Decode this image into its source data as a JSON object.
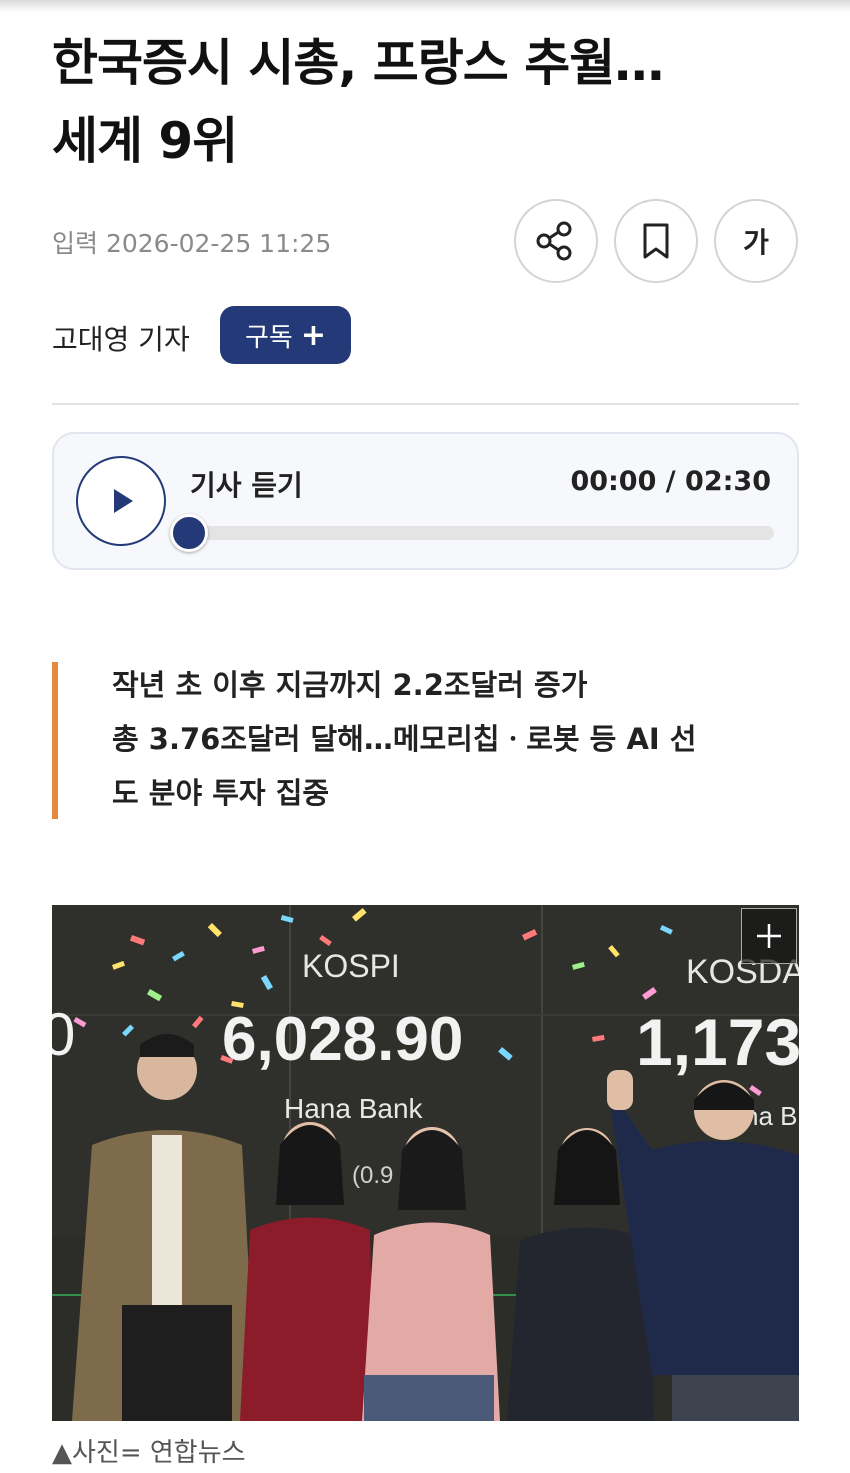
{
  "article": {
    "headline_line1": "한국증시 시총, 프랑스 추월…",
    "headline_line2": "세계 9위",
    "published": "입력 2026-02-25 11:25",
    "reporter": "고대영 기자",
    "subscribe_label": "구독",
    "subscribe_plus": "+",
    "font_size_label": "가",
    "summary_lines": [
      "작년 초 이후 지금까지 2.2조달러 증가",
      "총 3.76조달러 달해…메모리칩ㆍ로봇 등 AI 선",
      "도 분야 투자 집중"
    ],
    "photo_caption": "▲사진= 연합뉴스"
  },
  "audio_player": {
    "title": "기사 듣기",
    "time": "00:00 / 02:30",
    "progress": 0
  },
  "photo": {
    "board_labels": [
      "KOSPI",
      "KOSDA"
    ],
    "board_values": [
      "6,028.90",
      "1,173"
    ],
    "bank_label": "Hana Bank",
    "bank_label_right": "na B",
    "small_text": "(0.9",
    "left_partial": "0",
    "expand_icon": "+"
  },
  "colors": {
    "navy": "#243a78",
    "accent_orange": "#e58a3c",
    "board_bg": "#2a2b27"
  },
  "icons": [
    "share-icon",
    "bookmark-icon",
    "play-icon",
    "plus-icon",
    "expand-icon"
  ]
}
